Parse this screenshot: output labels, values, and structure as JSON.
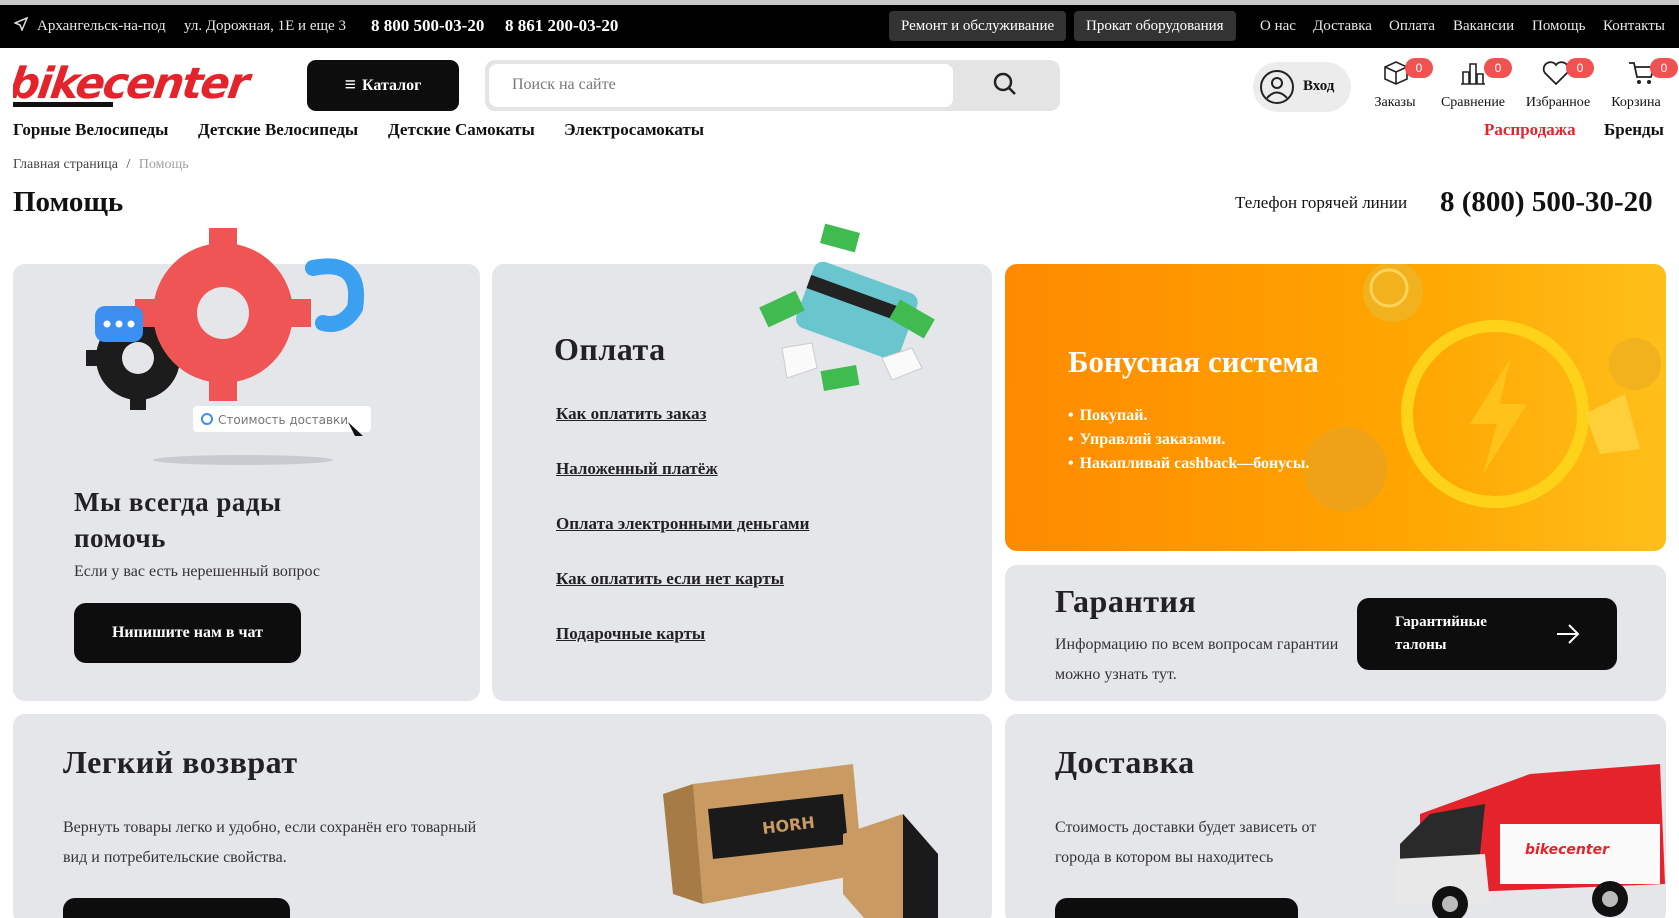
{
  "topbar": {
    "city": "Архангельск-на-под",
    "address": "ул. Дорожная, 1Е и еще 3",
    "phone1": "8 800 500-03-20",
    "phone2": "8 861 200-03-20",
    "repair": "Ремонт и обслуживание",
    "rental": "Прокат оборудования",
    "links": [
      "О нас",
      "Доставка",
      "Оплата",
      "Вакансии",
      "Помощь",
      "Контакты"
    ]
  },
  "header": {
    "logo_text": "bikecenter",
    "catalog_label": "Каталог",
    "search_placeholder": "Поиск на сайте",
    "login_label": "Вход",
    "icons": [
      {
        "label": "Заказы",
        "count": "0"
      },
      {
        "label": "Сравнение",
        "count": "0"
      },
      {
        "label": "Избранное",
        "count": "0"
      },
      {
        "label": "Корзина",
        "count": "0"
      }
    ]
  },
  "nav": {
    "items": [
      "Горные Велосипеды",
      "Детские Велосипеды",
      "Детские Самокаты",
      "Электросамокаты"
    ],
    "sale": "Распродажа",
    "brands": "Бренды"
  },
  "breadcrumb": {
    "home": "Главная страница",
    "sep": "/",
    "current": "Помощь"
  },
  "page": {
    "title": "Помощь",
    "hotline_label": "Телефон горячей линии",
    "hotline_number": "8 (800) 500-30-20"
  },
  "help_card": {
    "image_text": "Стоимость доставки",
    "title": "Мы всегда рады помочь",
    "text": "Если у вас есть нерешенный вопрос",
    "button": "Нипишите нам в чат"
  },
  "payment_card": {
    "title": "Оплата",
    "links": [
      "Как оплатить заказ",
      "Наложенный платёж",
      "Оплата электронными деньгами",
      "Как оплатить если нет карты",
      "Подарочные карты"
    ]
  },
  "bonus_card": {
    "title": "Бонусная система",
    "items": [
      "Покупай.",
      "Управляй заказами.",
      "Накапливай cashback—бонусы."
    ]
  },
  "warranty_card": {
    "title": "Гарантия",
    "text": "Информацию по всем вопросам гарантии можно узнать тут.",
    "button": "Гарантийные талоны"
  },
  "return_card": {
    "title": "Легкий возврат",
    "text": "Вернуть товары легко и удобно, если сохранён его товарный вид и потребительские свойства.",
    "box_brand": "HORH"
  },
  "delivery_card": {
    "title": "Доставка",
    "text": "Стоимость доставки будет зависеть от города в котором вы находитесь",
    "van_brand": "bikecenter"
  },
  "colors": {
    "accent_red": "#e5232b",
    "badge": "#f05252",
    "dark": "#0d0d0d",
    "card_bg": "#e4e6ea",
    "bonus_orange": "#ff9500"
  }
}
